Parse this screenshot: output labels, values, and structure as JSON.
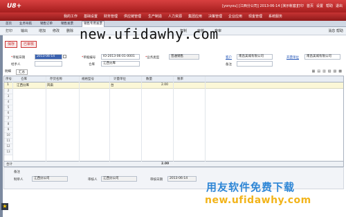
{
  "window": {
    "brand": "U8+",
    "status": "[yonyou] [江西分公司] 2013-06-14 [演示帐套]",
    "right_icons": [
      "打印",
      "首页",
      "设置",
      "帮助",
      "退出"
    ]
  },
  "menu": {
    "items": [
      "我的工作",
      "基础设置",
      "财务管理",
      "供应链管理",
      "生产制造",
      "人力资源",
      "集团应用",
      "决策管理",
      "企业应用",
      "现金管理",
      "系统服务"
    ]
  },
  "tabs": {
    "items": [
      "首页",
      "业务导航",
      "销售订单",
      "销售发票",
      "销售专用发票"
    ],
    "active_index": 4
  },
  "toolbar": {
    "items": [
      "打印",
      "输出",
      "增加",
      "修改",
      "删除",
      "复制",
      "审核",
      "弃审"
    ],
    "right": "消息  帮助"
  },
  "watermarks": {
    "top": "new.ufidawhy.com",
    "bottom_cn": "用友软件免费下载",
    "bottom_url": "new.ufidawhy.com"
  },
  "actions": {
    "save": "保存",
    "audit": "已审核"
  },
  "form": {
    "date_label": "单据日期",
    "date_value": "2013-06-14",
    "number_label": "单据编号",
    "number_value": "IO-2013-06-01-0001",
    "type_label": "业务类型",
    "type_value": "普通销售",
    "customer_label": "客户",
    "customer_value": "南昌美城有限公司",
    "billto_label": "开票单位",
    "billto_value": "南昌美城有限公司",
    "operator_label": "经手人",
    "operator_value": "",
    "warehouse_label": "仓库",
    "warehouse_value": "江西分库",
    "memo_label": "备注",
    "memo_value": ""
  },
  "detail": {
    "tab": "明细",
    "tab2": "汇总",
    "headers": [
      "序号",
      "仓库",
      "存货名称",
      "规格型号",
      "计量单位",
      "数量",
      "税率"
    ],
    "rows": [
      [
        "1",
        "江西分库",
        "风扇",
        "",
        "台",
        "2.00",
        ""
      ]
    ],
    "row_numbers": [
      "2",
      "3",
      "4",
      "5",
      "6",
      "7",
      "8",
      "9",
      "10",
      "11",
      "12",
      "13"
    ],
    "total_label": "合计",
    "total_qty": "2.00"
  },
  "footer": {
    "maker_label": "制单人",
    "maker_value": "江西分公司",
    "auditor_label": "审核人",
    "auditor_value": "江西分公司",
    "audit_date_label": "审核日期",
    "audit_date_value": "2013-06-14",
    "remarks_label": "备注"
  }
}
